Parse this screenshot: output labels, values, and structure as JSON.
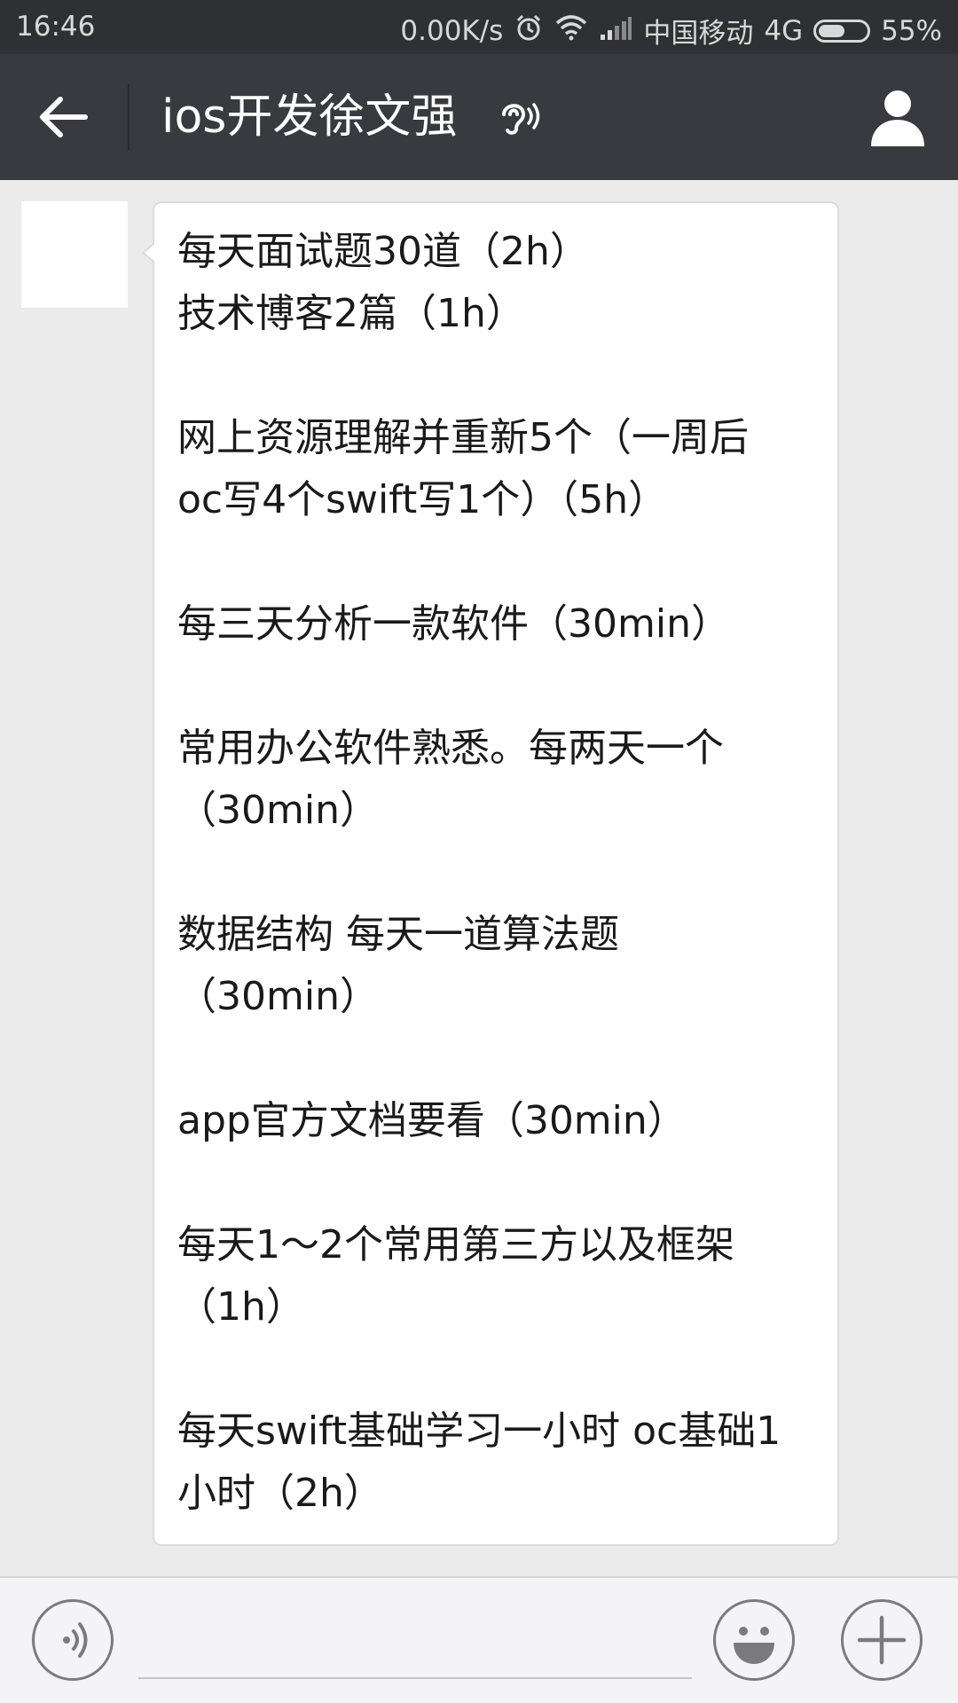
{
  "status_bar": {
    "time": "16:46",
    "network_speed": "0.00K/s",
    "carrier": "中国移动",
    "network_type": "4G",
    "battery_percent": "55%",
    "battery_level": 0.55,
    "icons": [
      "alarm-icon",
      "wifi-icon",
      "signal-icon",
      "battery-icon"
    ]
  },
  "title_bar": {
    "title": "ios开发徐文强",
    "earpiece_mode_icon": "ear-icon",
    "back_icon": "back-arrow-icon",
    "contact_icon": "person-icon"
  },
  "message": {
    "lines": [
      "每天面试题30道（2h）",
      "技术博客2篇（1h）",
      "",
      "网上资源理解并重新5个（一周后",
      "oc写4个swift写1个）（5h）",
      "",
      "每三天分析一款软件（30min）",
      "",
      "常用办公软件熟悉。每两天一个",
      "（30min）",
      "",
      "数据结构 每天一道算法题",
      "（30min）",
      "",
      "app官方文档要看（30min）",
      "",
      "每天1～2个常用第三方以及框架",
      "（1h）",
      "",
      "每天swift基础学习一小时 oc基础1",
      "小时（2h）"
    ]
  },
  "input_bar": {
    "text_value": "",
    "voice_icon": "voice-icon",
    "emoji_icon": "emoji-icon",
    "plus_icon": "plus-icon"
  },
  "colors": {
    "status_bar_bg": "#2e3033",
    "title_bar_bg": "#393a3f",
    "chat_bg": "#ebebeb",
    "bubble_bg": "#ffffff"
  }
}
